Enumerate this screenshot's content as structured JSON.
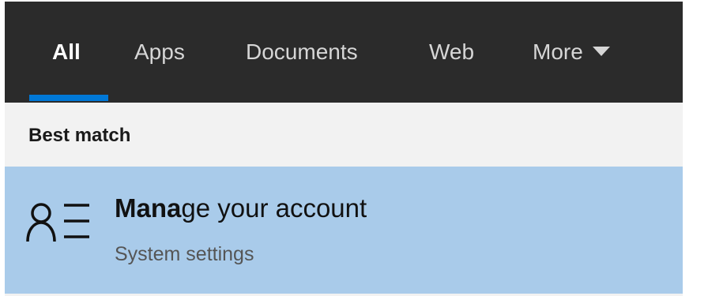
{
  "tabs": [
    {
      "label": "All",
      "active": true
    },
    {
      "label": "Apps",
      "active": false
    },
    {
      "label": "Documents",
      "active": false
    },
    {
      "label": "Web",
      "active": false
    },
    {
      "label": "More",
      "active": false
    }
  ],
  "section_label": "Best match",
  "best_match": {
    "title_highlight": "Mana",
    "title_rest": "ge your account",
    "subtitle": "System settings",
    "icon": "account-settings-icon"
  },
  "colors": {
    "tabbar_bg": "#2b2b2b",
    "accent": "#0078d7",
    "selected_bg": "#a9cbea",
    "panel_bg": "#f2f2f2"
  }
}
